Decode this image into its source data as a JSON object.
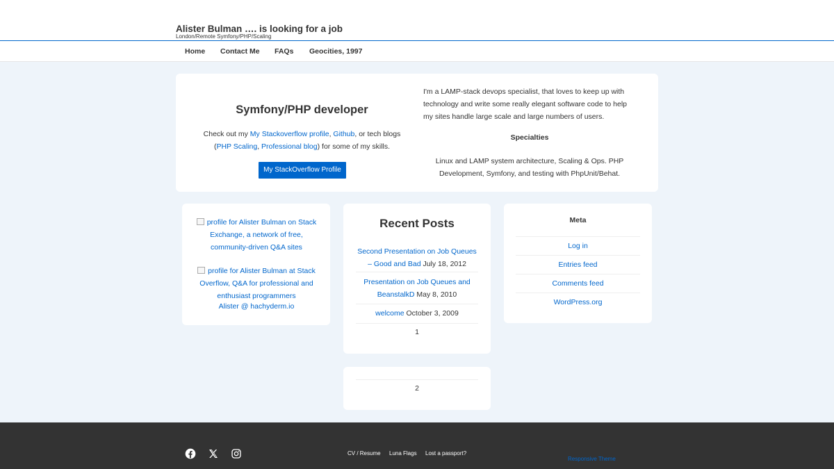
{
  "site": {
    "title": "Alister Bulman …. is looking for a job",
    "tagline": "London/Remote Symfony/PHP/Scaling"
  },
  "nav": [
    "Home",
    "Contact Me",
    "FAQs",
    "Geocities, 1997"
  ],
  "hero": {
    "title": "Symfony/PHP developer",
    "desc_prefix": "Check out my ",
    "link_stackoverflow": "My Stackoverflow profile",
    "sep1": ", ",
    "link_github": "Github",
    "sep2": ", or tech blogs (",
    "link_php_scaling": "PHP Scaling",
    "sep3": ", ",
    "link_professional": "Professional blog",
    "desc_suffix": ") for some of my skills.",
    "button_label": "My StackOverflow Profile",
    "intro": "I'm a LAMP-stack devops specialist, that loves to keep up with technology and write some really elegant software code to help my sites handle large scale and large numbers of users.",
    "specialties_heading": "Specialties",
    "specialties_text": "Linux and LAMP system architecture, Scaling & Ops. PHP Development, Symfony, and testing with PhpUnit/Behat."
  },
  "profiles": {
    "stack_exchange_alt": "profile for Alister Bulman on Stack Exchange, a network of free, community-driven Q&A sites",
    "stack_overflow_alt": "profile for Alister Bulman at Stack Overflow, Q&A for professional and enthusiast programmers",
    "mastodon": "Alister @ hachyderm.io"
  },
  "recent_posts": {
    "title": "Recent Posts",
    "items": [
      {
        "title": "Second Presentation on Job Queues – Good and Bad",
        "date": "July 18, 2012"
      },
      {
        "title": "Presentation on Job Queues and BeanstalkD",
        "date": "May 8, 2010"
      },
      {
        "title": "welcome",
        "date": "October 3, 2009"
      }
    ],
    "page_1": "1",
    "page_2": "2"
  },
  "meta": {
    "title": "Meta",
    "items": [
      "Log in",
      "Entries feed",
      "Comments feed",
      "WordPress.org"
    ]
  },
  "footer": {
    "social_icons": [
      "facebook-icon",
      "x-icon",
      "instagram-icon"
    ],
    "links": [
      "CV / Resume",
      "Luna Flags",
      "Lost a passport?"
    ],
    "theme_credit": "Responsive Theme"
  },
  "colors": {
    "link": "#0066cc",
    "page_background": "#eef4fa",
    "footer_background": "#333333",
    "button": "#0066cc"
  }
}
